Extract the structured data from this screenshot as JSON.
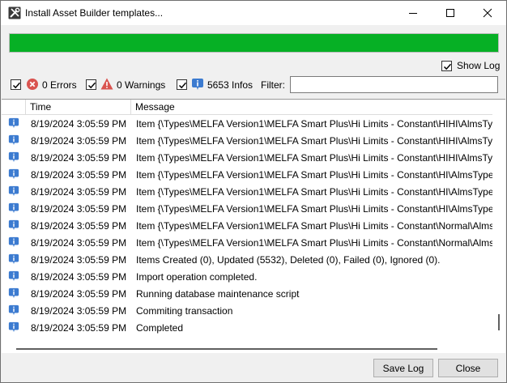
{
  "window": {
    "title": "Install Asset Builder templates..."
  },
  "progress": {
    "percent": 100,
    "color": "#06b025"
  },
  "show_log": {
    "label": "Show Log",
    "checked": true
  },
  "filters": {
    "errors": {
      "label": "0 Errors",
      "checked": true,
      "icon": "error-icon",
      "color": "#d9534f"
    },
    "warnings": {
      "label": "0 Warnings",
      "checked": true,
      "icon": "warning-icon",
      "color": "#d9534f"
    },
    "infos": {
      "label": "5653 Infos",
      "checked": true,
      "icon": "info-icon",
      "color": "#3c7bd0"
    },
    "filter_label": "Filter:",
    "filter_value": ""
  },
  "log": {
    "columns": [
      "",
      "Time",
      "Message"
    ],
    "rows": [
      {
        "icon": "info-icon",
        "time": "8/19/2024 3:05:59 PM",
        "message": "Item {\\Types\\MELFA Version1\\MELFA Smart Plus\\Hi Limits - Constant\\HIHI\\AlmsType"
      },
      {
        "icon": "info-icon",
        "time": "8/19/2024 3:05:59 PM",
        "message": "Item {\\Types\\MELFA Version1\\MELFA Smart Plus\\Hi Limits - Constant\\HIHI\\AlmsType"
      },
      {
        "icon": "info-icon",
        "time": "8/19/2024 3:05:59 PM",
        "message": "Item {\\Types\\MELFA Version1\\MELFA Smart Plus\\Hi Limits - Constant\\HIHI\\AlmsType"
      },
      {
        "icon": "info-icon",
        "time": "8/19/2024 3:05:59 PM",
        "message": "Item {\\Types\\MELFA Version1\\MELFA Smart Plus\\Hi Limits - Constant\\HI\\AlmsTypeS"
      },
      {
        "icon": "info-icon",
        "time": "8/19/2024 3:05:59 PM",
        "message": "Item {\\Types\\MELFA Version1\\MELFA Smart Plus\\Hi Limits - Constant\\HI\\AlmsTypeS"
      },
      {
        "icon": "info-icon",
        "time": "8/19/2024 3:05:59 PM",
        "message": "Item {\\Types\\MELFA Version1\\MELFA Smart Plus\\Hi Limits - Constant\\HI\\AlmsTypeS"
      },
      {
        "icon": "info-icon",
        "time": "8/19/2024 3:05:59 PM",
        "message": "Item {\\Types\\MELFA Version1\\MELFA Smart Plus\\Hi Limits - Constant\\Normal\\AlmsT"
      },
      {
        "icon": "info-icon",
        "time": "8/19/2024 3:05:59 PM",
        "message": "Item {\\Types\\MELFA Version1\\MELFA Smart Plus\\Hi Limits - Constant\\Normal\\AlmsT"
      },
      {
        "icon": "info-icon",
        "time": "8/19/2024 3:05:59 PM",
        "message": "Items Created (0), Updated (5532), Deleted (0), Failed (0), Ignored (0)."
      },
      {
        "icon": "info-icon",
        "time": "8/19/2024 3:05:59 PM",
        "message": "Import operation completed."
      },
      {
        "icon": "info-icon",
        "time": "8/19/2024 3:05:59 PM",
        "message": "Running database maintenance script"
      },
      {
        "icon": "info-icon",
        "time": "8/19/2024 3:05:59 PM",
        "message": "Commiting transaction"
      },
      {
        "icon": "info-icon",
        "time": "8/19/2024 3:05:59 PM",
        "message": "Completed"
      }
    ]
  },
  "buttons": {
    "save_log": "Save Log",
    "close": "Close"
  }
}
